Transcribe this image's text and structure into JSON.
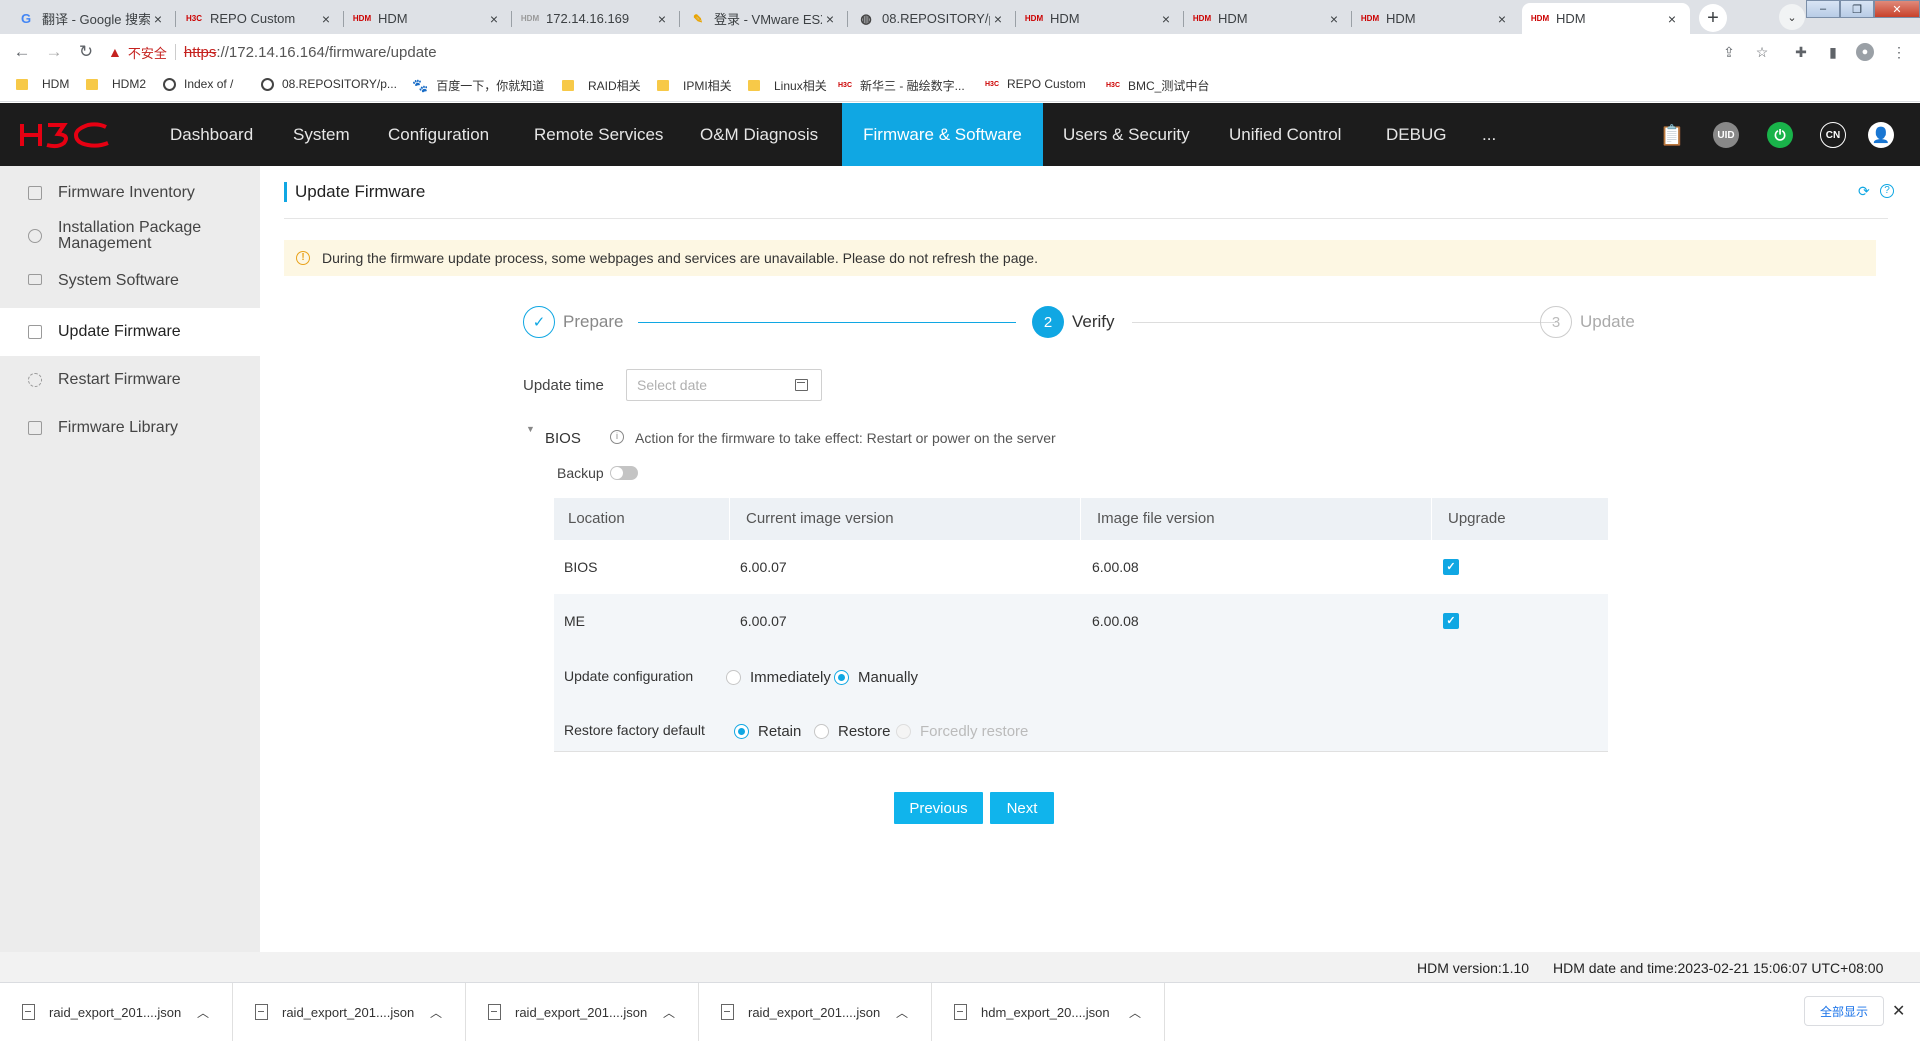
{
  "browser": {
    "tabs": [
      {
        "title": "翻译 - Google 搜索",
        "favicon": "google-icon",
        "active": false
      },
      {
        "title": "REPO Custom",
        "favicon": "h3c-icon",
        "active": false
      },
      {
        "title": "HDM",
        "favicon": "hdm-icon",
        "active": false
      },
      {
        "title": "172.14.16.169",
        "favicon": "hdm-icon",
        "active": false
      },
      {
        "title": "登录 - VMware ESXi",
        "favicon": "vmware-icon",
        "active": false
      },
      {
        "title": "08.REPOSITORY/p",
        "favicon": "globe-icon",
        "active": false
      },
      {
        "title": "HDM",
        "favicon": "hdm-icon",
        "active": false
      },
      {
        "title": "HDM",
        "favicon": "hdm-icon",
        "active": false
      },
      {
        "title": "HDM",
        "favicon": "hdm-icon",
        "active": false
      },
      {
        "title": "HDM",
        "favicon": "hdm-icon",
        "active": true
      }
    ],
    "address": {
      "insecure_label": "不安全",
      "scheme": "https",
      "rest": "://172.14.16.164/firmware/update"
    },
    "bookmarks": [
      {
        "label": "HDM",
        "icon": "folder-icon"
      },
      {
        "label": "HDM2",
        "icon": "folder-icon"
      },
      {
        "label": "Index of /",
        "icon": "globe-icon"
      },
      {
        "label": "08.REPOSITORY/p...",
        "icon": "globe-icon"
      },
      {
        "label": "百度一下，你就知道",
        "icon": "baidu-icon"
      },
      {
        "label": "RAID相关",
        "icon": "folder-icon"
      },
      {
        "label": "IPMI相关",
        "icon": "folder-icon"
      },
      {
        "label": "Linux相关",
        "icon": "folder-icon"
      },
      {
        "label": "新华三 - 融绘数字...",
        "icon": "h3c-icon"
      },
      {
        "label": "REPO Custom",
        "icon": "h3c-icon"
      },
      {
        "label": "BMC_测试中台",
        "icon": "h3c-icon"
      }
    ]
  },
  "app": {
    "brand_color": "#10a7e3",
    "logo_color": "#e60012",
    "nav": [
      {
        "label": "Dashboard",
        "active": false
      },
      {
        "label": "System",
        "active": false
      },
      {
        "label": "Configuration",
        "active": false
      },
      {
        "label": "Remote Services",
        "active": false
      },
      {
        "label": "O&M Diagnosis",
        "active": false
      },
      {
        "label": "Firmware & Software",
        "active": true
      },
      {
        "label": "Users & Security",
        "active": false
      },
      {
        "label": "Unified Control",
        "active": false
      },
      {
        "label": "DEBUG",
        "active": false
      },
      {
        "label": "...",
        "active": false
      }
    ],
    "header_icons": {
      "uid": "UID",
      "lang": "CN"
    },
    "sidebar": [
      {
        "label": "Firmware Inventory",
        "icon": "inventory-icon",
        "active": false
      },
      {
        "label": "Installation Package Management",
        "icon": "package-icon",
        "active": false
      },
      {
        "label": "System Software",
        "icon": "monitor-icon",
        "active": false
      },
      {
        "label": "Update Firmware",
        "icon": "update-icon",
        "active": true
      },
      {
        "label": "Restart Firmware",
        "icon": "restart-icon",
        "active": false
      },
      {
        "label": "Firmware Library",
        "icon": "library-icon",
        "active": false
      }
    ]
  },
  "page": {
    "title": "Update Firmware",
    "notice": "During the firmware update process, some webpages and services are unavailable. Please do not refresh the page.",
    "steps": [
      {
        "num": "✓",
        "label": "Prepare",
        "state": "done"
      },
      {
        "num": "2",
        "label": "Verify",
        "state": "current"
      },
      {
        "num": "3",
        "label": "Update",
        "state": "pending"
      }
    ],
    "update_time": {
      "label": "Update time",
      "placeholder": "Select date",
      "value": ""
    },
    "section": {
      "name": "BIOS",
      "action_note": "Action for the firmware to take effect: Restart or power on the server",
      "backup_label": "Backup",
      "backup_on": false
    },
    "table": {
      "headers": [
        "Location",
        "Current image version",
        "Image file version",
        "Upgrade"
      ],
      "rows": [
        {
          "location": "BIOS",
          "current": "6.00.07",
          "image": "6.00.08",
          "upgrade": true
        },
        {
          "location": "ME",
          "current": "6.00.07",
          "image": "6.00.08",
          "upgrade": true
        }
      ]
    },
    "update_config": {
      "label": "Update configuration",
      "options": [
        "Immediately",
        "Manually"
      ],
      "selected": "Manually"
    },
    "restore_default": {
      "label": "Restore factory default",
      "options": [
        "Retain",
        "Restore",
        "Forcedly restore"
      ],
      "selected": "Retain",
      "disabled": [
        "Forcedly restore"
      ]
    },
    "buttons": {
      "previous": "Previous",
      "next": "Next"
    }
  },
  "footer": {
    "version": "HDM version:1.10",
    "datetime": "HDM date and time:2023-02-21 15:06:07 UTC+08:00"
  },
  "downloads": {
    "items": [
      "raid_export_201....json",
      "raid_export_201....json",
      "raid_export_201....json",
      "raid_export_201....json",
      "hdm_export_20....json"
    ],
    "show_all": "全部显示"
  }
}
